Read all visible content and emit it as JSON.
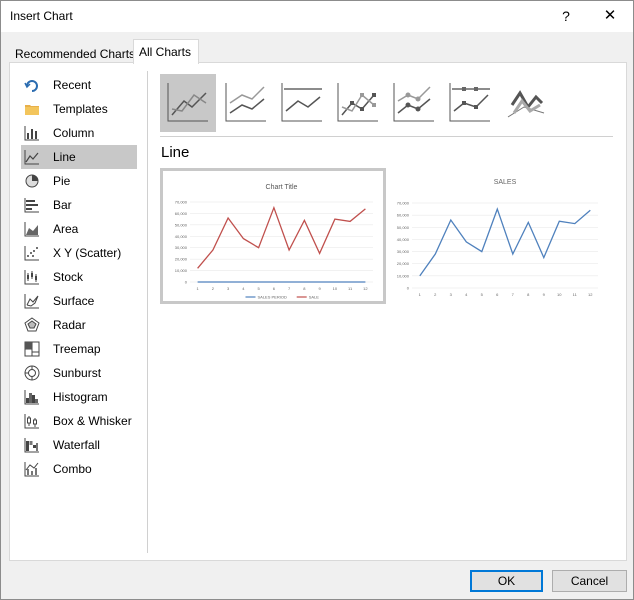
{
  "window": {
    "title": "Insert Chart",
    "help_label": "?",
    "close_label": "✕"
  },
  "tabs": [
    {
      "label": "Recommended Charts",
      "selected": false
    },
    {
      "label": "All Charts",
      "selected": true
    }
  ],
  "sidebar": {
    "items": [
      {
        "label": "Recent",
        "icon": "recent-icon"
      },
      {
        "label": "Templates",
        "icon": "folder-icon"
      },
      {
        "label": "Column",
        "icon": "column-chart-icon"
      },
      {
        "label": "Line",
        "icon": "line-chart-icon",
        "selected": true
      },
      {
        "label": "Pie",
        "icon": "pie-chart-icon"
      },
      {
        "label": "Bar",
        "icon": "bar-chart-icon"
      },
      {
        "label": "Area",
        "icon": "area-chart-icon"
      },
      {
        "label": "X Y (Scatter)",
        "icon": "scatter-chart-icon"
      },
      {
        "label": "Stock",
        "icon": "stock-chart-icon"
      },
      {
        "label": "Surface",
        "icon": "surface-chart-icon"
      },
      {
        "label": "Radar",
        "icon": "radar-chart-icon"
      },
      {
        "label": "Treemap",
        "icon": "treemap-chart-icon"
      },
      {
        "label": "Sunburst",
        "icon": "sunburst-chart-icon"
      },
      {
        "label": "Histogram",
        "icon": "histogram-chart-icon"
      },
      {
        "label": "Box & Whisker",
        "icon": "box-whisker-chart-icon"
      },
      {
        "label": "Waterfall",
        "icon": "waterfall-chart-icon"
      },
      {
        "label": "Combo",
        "icon": "combo-chart-icon"
      }
    ]
  },
  "main": {
    "heading": "Line",
    "subtype_icons": [
      "line-icon",
      "stacked-line-icon",
      "100-stacked-line-icon",
      "line-markers-icon",
      "stacked-line-markers-icon",
      "100-stacked-line-markers-icon",
      "3d-line-icon"
    ],
    "colors": {
      "red_series": "#c0504d",
      "blue_series": "#4f81bd",
      "selection": "#c8c8c8"
    }
  },
  "chart_data": [
    {
      "type": "line",
      "title": "Chart Title",
      "categories": [
        "1",
        "2",
        "3",
        "4",
        "5",
        "6",
        "7",
        "8",
        "9",
        "10",
        "11",
        "12"
      ],
      "ylim": [
        0,
        70000
      ],
      "y_ticks": [
        "0",
        "10,000",
        "20,000",
        "30,000",
        "40,000",
        "50,000",
        "60,000",
        "70,000"
      ],
      "series": [
        {
          "name": "SALES PERIOD",
          "values": [
            0,
            0,
            0,
            0,
            0,
            0,
            0,
            0,
            0,
            0,
            0,
            0
          ],
          "color": "#4f81bd"
        },
        {
          "name": "SALE",
          "values": [
            12000,
            28000,
            56000,
            38000,
            30000,
            65000,
            28000,
            54000,
            25000,
            55000,
            53000,
            64000
          ],
          "color": "#c0504d"
        }
      ],
      "legend": "bottom"
    },
    {
      "type": "line",
      "title": "SALES",
      "categories": [
        "1",
        "2",
        "3",
        "4",
        "5",
        "6",
        "7",
        "8",
        "9",
        "10",
        "11",
        "12"
      ],
      "ylim": [
        0,
        70000
      ],
      "y_ticks": [
        "0",
        "10,000",
        "20,000",
        "30,000",
        "40,000",
        "50,000",
        "60,000",
        "70,000"
      ],
      "series": [
        {
          "values": [
            10000,
            28000,
            56000,
            38000,
            30000,
            65000,
            28000,
            54000,
            25000,
            55000,
            53000,
            64000
          ],
          "color": "#4f81bd"
        }
      ],
      "legend": "none"
    }
  ],
  "buttons": {
    "ok": "OK",
    "cancel": "Cancel"
  }
}
